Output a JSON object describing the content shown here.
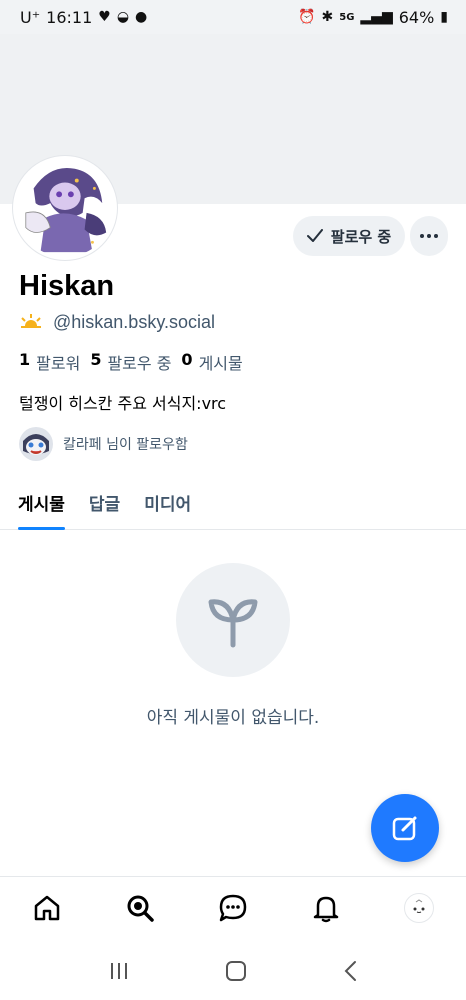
{
  "status_bar": {
    "carrier": "U⁺",
    "time": "16:11",
    "battery": "64%",
    "icons_left": [
      "heart-icon",
      "bowl-icon",
      "chat-bubbles-icon"
    ],
    "icons_right": [
      "alarm-icon",
      "bluetooth-icon",
      "5g-icon",
      "signal-icon",
      "battery-icon"
    ]
  },
  "profile": {
    "display_name": "Hiskan",
    "handle": "@hiskan.bsky.social",
    "handle_badge_icon": "sun-emoji-icon",
    "bio": "털쟁이 히스칸 주요 서식지:vrc",
    "follow_button_label": "팔로우 중",
    "more_icon": "ellipsis-icon"
  },
  "stats": {
    "followers_count": "1",
    "followers_label": "팔로워",
    "following_count": "5",
    "following_label": "팔로우 중",
    "posts_count": "0",
    "posts_label": "게시물"
  },
  "followed_by": {
    "text": "칼라페 님이 팔로우함"
  },
  "tabs": [
    {
      "label": "게시물",
      "active": true
    },
    {
      "label": "답글",
      "active": false
    },
    {
      "label": "미디어",
      "active": false
    }
  ],
  "empty_state": {
    "icon": "sprout-icon",
    "message": "아직 게시물이 없습니다."
  },
  "fab": {
    "icon": "compose-icon"
  },
  "bottom_nav": [
    {
      "name": "home-icon"
    },
    {
      "name": "search-icon"
    },
    {
      "name": "chat-icon"
    },
    {
      "name": "bell-icon"
    },
    {
      "name": "profile-avatar"
    }
  ],
  "colors": {
    "accent": "#1083fe",
    "fab": "#1f7aff",
    "muted_text": "#42576c",
    "banner": "#eff1f3"
  }
}
